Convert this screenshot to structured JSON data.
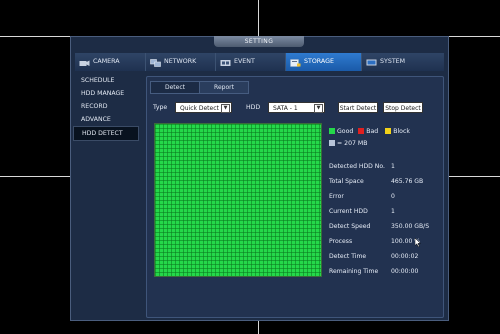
{
  "window": {
    "title": "SETTING"
  },
  "main_nav": [
    {
      "label": "CAMERA",
      "icon": "camera-icon"
    },
    {
      "label": "NETWORK",
      "icon": "network-icon"
    },
    {
      "label": "EVENT",
      "icon": "event-icon"
    },
    {
      "label": "STORAGE",
      "icon": "storage-icon",
      "active": true
    },
    {
      "label": "SYSTEM",
      "icon": "system-icon"
    }
  ],
  "sidebar": [
    {
      "label": "SCHEDULE"
    },
    {
      "label": "HDD MANAGE"
    },
    {
      "label": "RECORD"
    },
    {
      "label": "ADVANCE"
    },
    {
      "label": "HDD DETECT",
      "active": true
    }
  ],
  "tabs": [
    {
      "label": "Detect",
      "active": true
    },
    {
      "label": "Report"
    }
  ],
  "controls": {
    "type_label": "Type",
    "type_value": "Quick Detect",
    "hdd_label": "HDD",
    "hdd_value": "SATA - 1",
    "start_button": "Start Detect",
    "stop_button": "Stop Detect"
  },
  "legend": {
    "good": "Good",
    "bad": "Bad",
    "block": "Block",
    "block_size": "= 207 MB",
    "colors": {
      "good": "#25d84a",
      "bad": "#e02020",
      "block": "#f2d21a",
      "size": "#b8c4d8"
    }
  },
  "detect_grid": {
    "status": "good",
    "fill_color": "#25d84a"
  },
  "info": [
    {
      "key": "Detected HDD No.",
      "value": "1"
    },
    {
      "key": "Total Space",
      "value": "465.76 GB"
    },
    {
      "key": "Error",
      "value": "0"
    },
    {
      "key": "Current HDD",
      "value": "1"
    },
    {
      "key": "Detect Speed",
      "value": "350.00 GB/S"
    },
    {
      "key": "Process",
      "value": "100.00 %"
    },
    {
      "key": "Detect Time",
      "value": "00:00:02"
    },
    {
      "key": "Remaining Time",
      "value": "00:00:00"
    }
  ]
}
